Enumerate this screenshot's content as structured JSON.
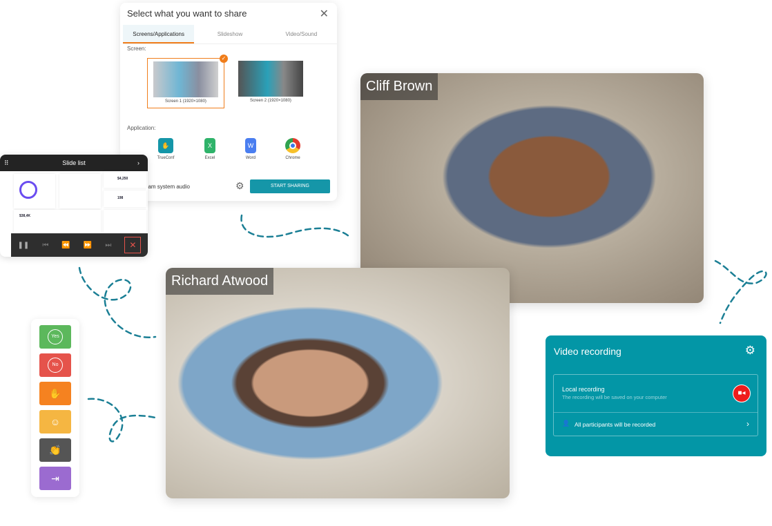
{
  "share_dialog": {
    "title": "Select what you want to share",
    "tabs": [
      "Screens/Applications",
      "Slideshow",
      "Video/Sound"
    ],
    "active_tab": "Screens/Applications",
    "screen_label": "Screen:",
    "screens": [
      {
        "label": "Screen 1 (1920×1080)",
        "selected": true
      },
      {
        "label": "Screen 2 (1920×1080)",
        "selected": false
      }
    ],
    "application_label": "Application:",
    "apps": [
      {
        "label": "TrueConf",
        "color": "#1596a8"
      },
      {
        "label": "Excel",
        "color": "#2fb36a"
      },
      {
        "label": "Word",
        "color": "#4a7ef0"
      },
      {
        "label": "Chrome",
        "color": "#e33b2e"
      }
    ],
    "audio_label": "eam system audio",
    "start_button": "START SHARING"
  },
  "slide_list": {
    "title": "Slide list",
    "values": [
      "$4,250",
      "198",
      "$38,4K"
    ]
  },
  "participants": [
    {
      "name": "Cliff Brown"
    },
    {
      "name": "Richard Atwood"
    }
  ],
  "reactions": [
    {
      "label": "Yes",
      "color": "#5cb85c"
    },
    {
      "label": "No",
      "color": "#e5534b"
    },
    {
      "icon": "raise-hand",
      "color": "#f58220"
    },
    {
      "icon": "smile",
      "color": "#f5b642"
    },
    {
      "icon": "applause",
      "color": "#555555"
    },
    {
      "icon": "exit",
      "color": "#9b6bd0"
    }
  ],
  "recording": {
    "title": "Video recording",
    "local_title": "Local recording",
    "local_subtitle": "The recording will be saved on your computer",
    "participants_text": "All participants will be recorded",
    "accent": "#0396a6",
    "record_color": "#ee1c1c"
  }
}
